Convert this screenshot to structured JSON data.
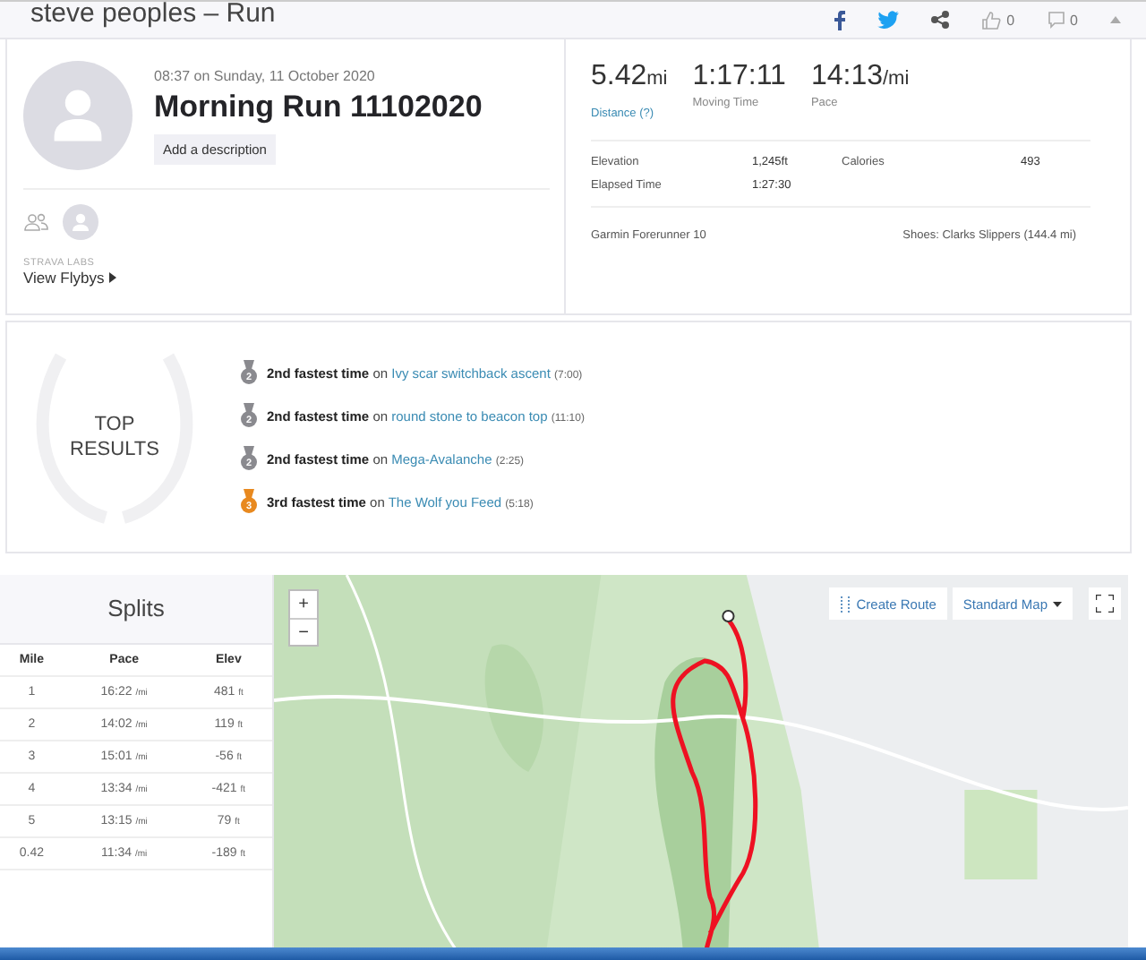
{
  "header": {
    "title": "steve peoples – Run",
    "like_count": "0",
    "comment_count": "0"
  },
  "activity": {
    "datetime": "08:37 on Sunday, 11 October 2020",
    "title": "Morning Run 11102020",
    "description_button": "Add a description",
    "labs_label": "STRAVA LABS",
    "flybys_link": "View Flybys"
  },
  "stats": [
    {
      "value": "5.42",
      "unit": "mi",
      "label": "Distance (?)",
      "kind": "link"
    },
    {
      "value": "1:17:11",
      "label": "Moving Time",
      "kind": "plain"
    },
    {
      "value": "14:13",
      "unit": "/mi",
      "label": "Pace",
      "kind": "plain"
    }
  ],
  "details": [
    {
      "label": "Elevation",
      "value": "1,245ft"
    },
    {
      "label": "Calories",
      "value": "493"
    },
    {
      "label": "Elapsed Time",
      "value": "1:27:30"
    }
  ],
  "gear": {
    "device": "Garmin Forerunner 10",
    "shoes": "Shoes: Clarks Slippers (144.4 mi)"
  },
  "top_results": {
    "title_lines": [
      "TOP",
      "RESULTS"
    ],
    "items": [
      {
        "rank": "2",
        "color": "#8a8a8f",
        "text": "**2nd fastest time** on",
        "segment": "Ivy scar switchback ascent",
        "time": "(7:00)"
      },
      {
        "rank": "2",
        "color": "#8a8a8f",
        "text": "**2nd fastest time** on",
        "segment": "round stone to beacon top",
        "time": "(11:10)"
      },
      {
        "rank": "2",
        "color": "#8a8a8f",
        "text": "**2nd fastest time** on",
        "segment": "Mega-Avalanche",
        "time": "(2:25)"
      },
      {
        "rank": "3",
        "color": "#e8891f",
        "text": "**3rd fastest time** on",
        "segment": "The Wolf you Feed",
        "time": "(5:18)"
      }
    ]
  },
  "splits": {
    "title": "Splits",
    "columns": [
      "Mile",
      "Pace",
      "Elev"
    ],
    "rows": [
      {
        "mile": "1",
        "pace": "16:22",
        "pace_unit": "/mi",
        "elev": "481",
        "elev_unit": "ft"
      },
      {
        "mile": "2",
        "pace": "14:02",
        "pace_unit": "/mi",
        "elev": "119",
        "elev_unit": "ft"
      },
      {
        "mile": "3",
        "pace": "15:01",
        "pace_unit": "/mi",
        "elev": "-56",
        "elev_unit": "ft"
      },
      {
        "mile": "4",
        "pace": "13:34",
        "pace_unit": "/mi",
        "elev": "-421",
        "elev_unit": "ft"
      },
      {
        "mile": "5",
        "pace": "13:15",
        "pace_unit": "/mi",
        "elev": "79",
        "elev_unit": "ft"
      },
      {
        "mile": "0.42",
        "pace": "11:34",
        "pace_unit": "/mi",
        "elev": "-189",
        "elev_unit": "ft"
      }
    ]
  },
  "map": {
    "zoom_in": "+",
    "zoom_out": "−",
    "create_route": "Create Route",
    "map_type": "Standard Map"
  }
}
